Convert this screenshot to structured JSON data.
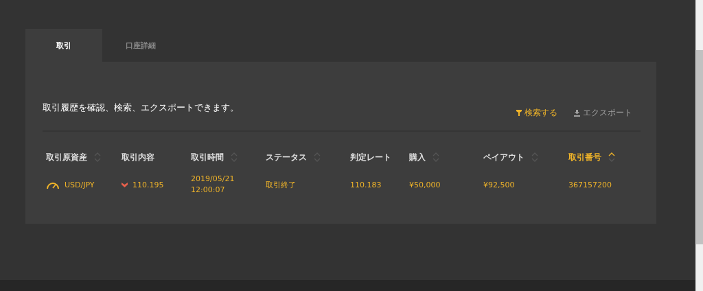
{
  "tabs": [
    {
      "label": "取引",
      "selected": true
    },
    {
      "label": "口座詳細",
      "selected": false
    }
  ],
  "description": "取引履歴を確認、検索、エクスポートできます。",
  "actions": [
    {
      "kind": "search",
      "label": "検索する",
      "disabled": false
    },
    {
      "kind": "export",
      "label": "エクスポート",
      "disabled": true
    }
  ],
  "table": {
    "columns": [
      {
        "label": "取引原資産",
        "kind": "sortable",
        "selected": false
      },
      {
        "label": "取引内容",
        "kind": "plain",
        "selected": false
      },
      {
        "label": "取引時間",
        "kind": "sortable",
        "selected": false
      },
      {
        "label": "ステータス",
        "kind": "sortable",
        "selected": false
      },
      {
        "label": "判定レート",
        "kind": "plain",
        "selected": false
      },
      {
        "label": "購入",
        "kind": "sortable",
        "selected": false
      },
      {
        "label": "ペイアウト",
        "kind": "sortable",
        "selected": false
      },
      {
        "label": "取引番号",
        "kind": "sortable",
        "selected": true
      }
    ],
    "rows": [
      {
        "asset": "USD/JPY",
        "falling": true,
        "rate": "110.195",
        "time": [
          "2019/05/21",
          "12:00:07"
        ],
        "status": "取引終了",
        "result_rate": "110.183",
        "purchase": "¥50,000",
        "payout": "¥92,500",
        "number": "367157200"
      }
    ]
  }
}
